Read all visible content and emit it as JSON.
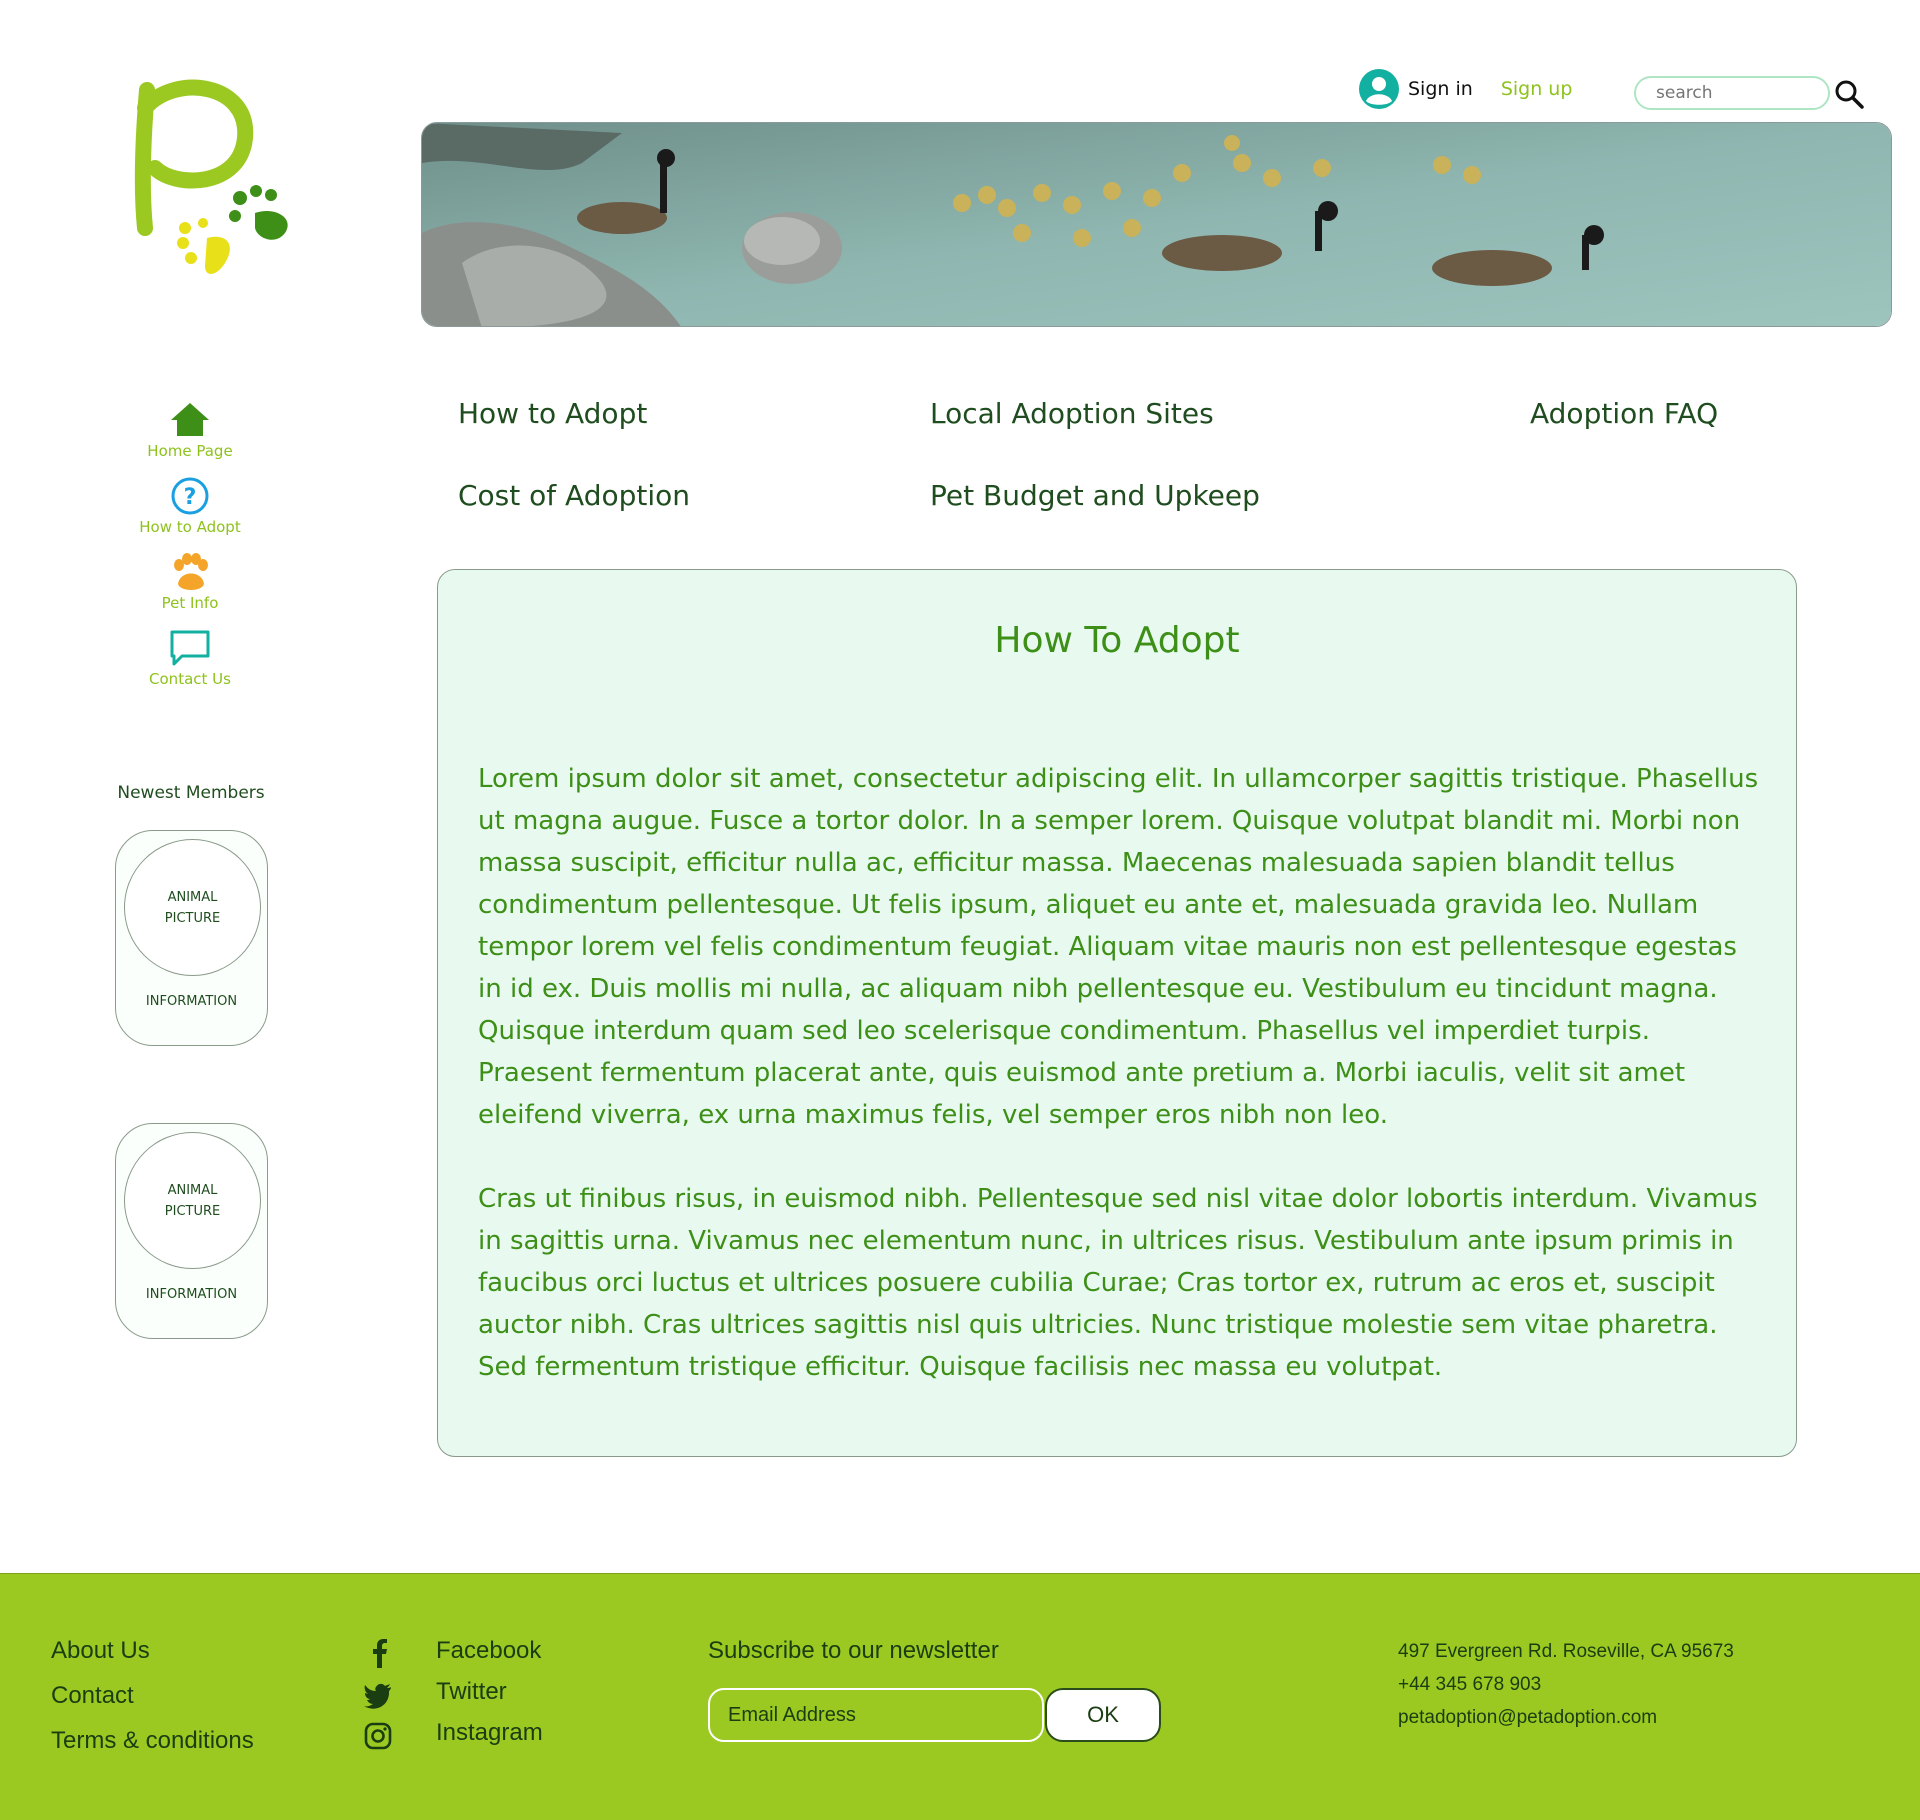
{
  "colors": {
    "brand_green": "#9bc922",
    "dark_green": "#1f4d1f",
    "text_green": "#3d8f18",
    "content_bg": "#e8faef",
    "teal": "#12b0a0",
    "blue": "#1aa0e0",
    "orange": "#f5a42a"
  },
  "header": {
    "sign_in": "Sign in",
    "sign_up": "Sign up",
    "search_placeholder": "search",
    "user_icon": "user-circle-icon",
    "search_icon": "magnifier-icon"
  },
  "sidebar": {
    "items": [
      {
        "label": "Home Page",
        "icon": "home-icon"
      },
      {
        "label": "How to Adopt",
        "icon": "question-icon"
      },
      {
        "label": "Pet Info",
        "icon": "paw-icon"
      },
      {
        "label": "Contact Us",
        "icon": "chat-icon"
      }
    ],
    "members_title": "Newest Members",
    "members": [
      {
        "picture": "ANIMAL\nPICTURE",
        "info": "INFORMATION"
      },
      {
        "picture": "ANIMAL\nPICTURE",
        "info": "INFORMATION"
      }
    ]
  },
  "topnav": {
    "links": [
      "How to Adopt",
      "Local Adoption Sites",
      "Adoption FAQ",
      "Cost of Adoption",
      "Pet Budget and Upkeep"
    ]
  },
  "main": {
    "title": "How To Adopt",
    "paragraphs": [
      "Lorem ipsum dolor sit amet, consectetur adipiscing elit. In ullamcorper sagittis tristique. Phasellus ut magna augue. Fusce a tortor dolor. In a semper lorem. Quisque volutpat blandit mi. Morbi non massa suscipit, efficitur nulla ac, efficitur massa. Maecenas malesuada sapien blandit tellus condimentum pellentesque. Ut felis ipsum, aliquet eu ante et, malesuada gravida leo. Nullam tempor lorem vel felis condimentum feugiat. Aliquam vitae mauris non est pellentesque egestas in id ex. Duis mollis mi nulla, ac aliquam nibh pellentesque eu. Vestibulum eu tincidunt magna. Quisque interdum quam sed leo scelerisque condimentum. Phasellus vel imperdiet turpis. Praesent fermentum placerat ante, quis euismod ante pretium a. Morbi iaculis, velit sit amet eleifend viverra, ex urna maximus felis, vel semper eros nibh non leo.",
      "Cras ut finibus risus, in euismod nibh. Pellentesque sed nisl vitae dolor lobortis interdum. Vivamus in sagittis urna. Vivamus nec elementum nunc, in ultrices risus. Vestibulum ante ipsum primis in faucibus orci luctus et ultrices posuere cubilia Curae; Cras tortor ex, rutrum ac eros et, suscipit auctor nibh. Cras ultrices sagittis nisl quis ultricies. Nunc tristique molestie sem vitae pharetra. Sed fermentum tristique efficitur. Quisque facilisis nec massa eu volutpat."
    ]
  },
  "footer": {
    "links": [
      "About Us",
      "Contact",
      "Terms & conditions"
    ],
    "social": [
      {
        "label": "Facebook",
        "icon": "facebook-icon"
      },
      {
        "label": "Twitter",
        "icon": "twitter-icon"
      },
      {
        "label": "Instagram",
        "icon": "instagram-icon"
      }
    ],
    "newsletter_title": "Subscribe to our newsletter",
    "email_placeholder": "Email Address",
    "ok_label": "OK",
    "address": "497 Evergreen Rd. Roseville, CA 95673",
    "phone": "+44 345 678 903",
    "email": "petadoption@petadoption.com"
  }
}
